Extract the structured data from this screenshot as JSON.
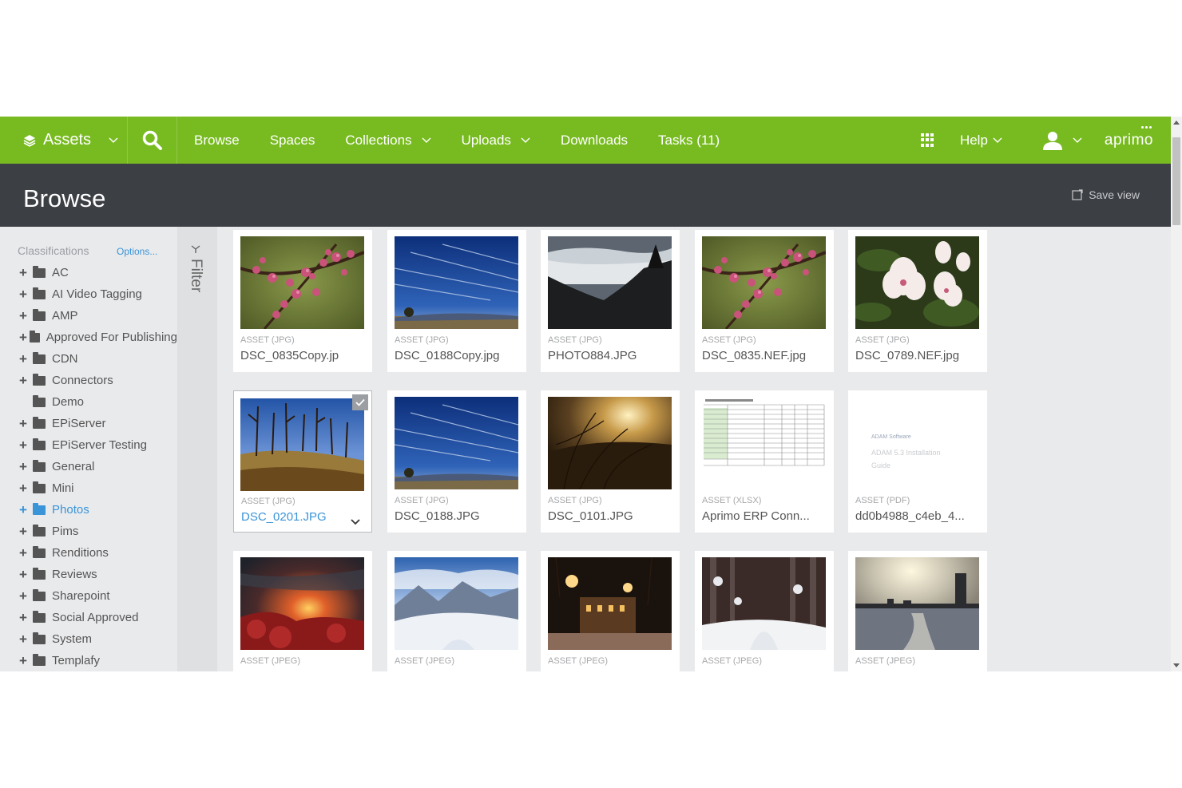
{
  "nav": {
    "assets_label": "Assets",
    "items": [
      {
        "label": "Browse",
        "has_dropdown": false
      },
      {
        "label": "Spaces",
        "has_dropdown": false
      },
      {
        "label": "Collections",
        "has_dropdown": true
      },
      {
        "label": "Uploads",
        "has_dropdown": true
      },
      {
        "label": "Downloads",
        "has_dropdown": false
      },
      {
        "label": "Tasks (11)",
        "has_dropdown": false
      }
    ],
    "help_label": "Help",
    "brand": "aprimo",
    "icons": {
      "assets": "layers-icon",
      "search": "search-icon",
      "apps": "apps-grid-icon",
      "user": "user-icon"
    }
  },
  "header": {
    "title": "Browse",
    "save_view": "Save view"
  },
  "sidebar": {
    "heading": "Classifications",
    "options_label": "Options...",
    "items": [
      {
        "label": "AC",
        "expandable": true,
        "active": false
      },
      {
        "label": "AI Video Tagging",
        "expandable": true,
        "active": false
      },
      {
        "label": "AMP",
        "expandable": true,
        "active": false
      },
      {
        "label": "Approved For Publishing",
        "expandable": true,
        "active": false
      },
      {
        "label": "CDN",
        "expandable": true,
        "active": false
      },
      {
        "label": "Connectors",
        "expandable": true,
        "active": false
      },
      {
        "label": "Demo",
        "expandable": false,
        "active": false
      },
      {
        "label": "EPiServer",
        "expandable": true,
        "active": false
      },
      {
        "label": "EPiServer Testing",
        "expandable": true,
        "active": false
      },
      {
        "label": "General",
        "expandable": true,
        "active": false
      },
      {
        "label": "Mini",
        "expandable": true,
        "active": false
      },
      {
        "label": "Photos",
        "expandable": true,
        "active": true
      },
      {
        "label": "Pims",
        "expandable": true,
        "active": false
      },
      {
        "label": "Renditions",
        "expandable": true,
        "active": false
      },
      {
        "label": "Reviews",
        "expandable": true,
        "active": false
      },
      {
        "label": "Sharepoint",
        "expandable": true,
        "active": false
      },
      {
        "label": "Social Approved",
        "expandable": true,
        "active": false
      },
      {
        "label": "System",
        "expandable": true,
        "active": false
      },
      {
        "label": "Templafy",
        "expandable": true,
        "active": false
      }
    ]
  },
  "filter": {
    "label": "Filter"
  },
  "assets": [
    {
      "type": "ASSET (JPG)",
      "name": "DSC_0835Copy.jp",
      "thumb": "blossom",
      "selected": false
    },
    {
      "type": "ASSET (JPG)",
      "name": "DSC_0188Copy.jpg",
      "thumb": "sky",
      "selected": false
    },
    {
      "type": "ASSET (JPG)",
      "name": "PHOTO884.JPG",
      "thumb": "fog",
      "selected": false
    },
    {
      "type": "ASSET (JPG)",
      "name": "DSC_0835.NEF.jpg",
      "thumb": "blossom",
      "selected": false
    },
    {
      "type": "ASSET (JPG)",
      "name": "DSC_0789.NEF.jpg",
      "thumb": "magnolia",
      "selected": false
    },
    {
      "type": "ASSET (JPG)",
      "name": "DSC_0201.JPG",
      "thumb": "trees",
      "selected": true
    },
    {
      "type": "ASSET (JPG)",
      "name": "DSC_0188.JPG",
      "thumb": "sky",
      "selected": false
    },
    {
      "type": "ASSET (JPG)",
      "name": "DSC_0101.JPG",
      "thumb": "sunset-grass",
      "selected": false
    },
    {
      "type": "ASSET (XLSX)",
      "name": "Aprimo ERP Conn...",
      "thumb": "spreadsheet",
      "selected": false
    },
    {
      "type": "ASSET (PDF)",
      "name": "dd0b4988_c4eb_4...",
      "thumb": "pdf-doc",
      "selected": false
    },
    {
      "type": "ASSET (JPEG)",
      "name": "",
      "thumb": "red-sunset",
      "selected": false
    },
    {
      "type": "ASSET (JPEG)",
      "name": "",
      "thumb": "snow-mountain",
      "selected": false
    },
    {
      "type": "ASSET (JPEG)",
      "name": "",
      "thumb": "night-street",
      "selected": false
    },
    {
      "type": "ASSET (JPEG)",
      "name": "",
      "thumb": "snow-forest",
      "selected": false
    },
    {
      "type": "ASSET (JPEG)",
      "name": "",
      "thumb": "lake-city",
      "selected": false
    }
  ],
  "pdf_preview": {
    "line1": "ADAM Software",
    "line2": "ADAM 5.3 Installation",
    "line3": "Guide"
  },
  "colors": {
    "brand_green": "#78bb21",
    "header_dark": "#3c3f44",
    "link_blue": "#3a94d8"
  }
}
